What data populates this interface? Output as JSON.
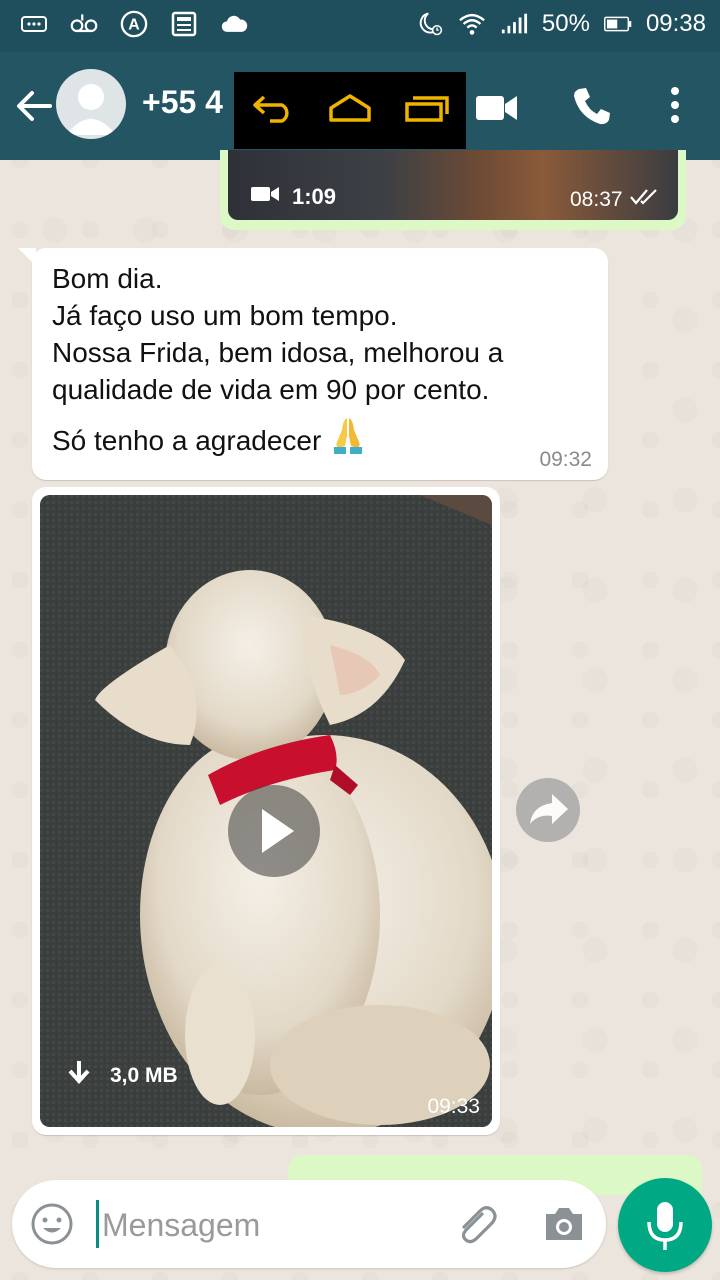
{
  "status_bar": {
    "battery": "50%",
    "time": "09:38"
  },
  "header": {
    "contact": "+55 4"
  },
  "messages": {
    "sent_video_top": {
      "duration": "1:09",
      "time": "08:37"
    },
    "received_text": {
      "lines": [
        "Bom dia.",
        "Já faço uso um bom tempo.",
        "Nossa Frida, bem idosa, melhorou a",
        "qualidade de vida em 90 por cento."
      ],
      "last_line": "Só tenho a agradecer",
      "time": "09:32"
    },
    "received_video": {
      "size": "3,0 MB",
      "time": "09:33"
    }
  },
  "composer": {
    "placeholder": "Mensagem"
  },
  "colors": {
    "header": "#245563",
    "status_bar": "#1f4e5c",
    "outgoing_bubble": "#dcf8c6",
    "mic_button": "#00a884",
    "nav_overlay_icons": "#f0b400"
  }
}
